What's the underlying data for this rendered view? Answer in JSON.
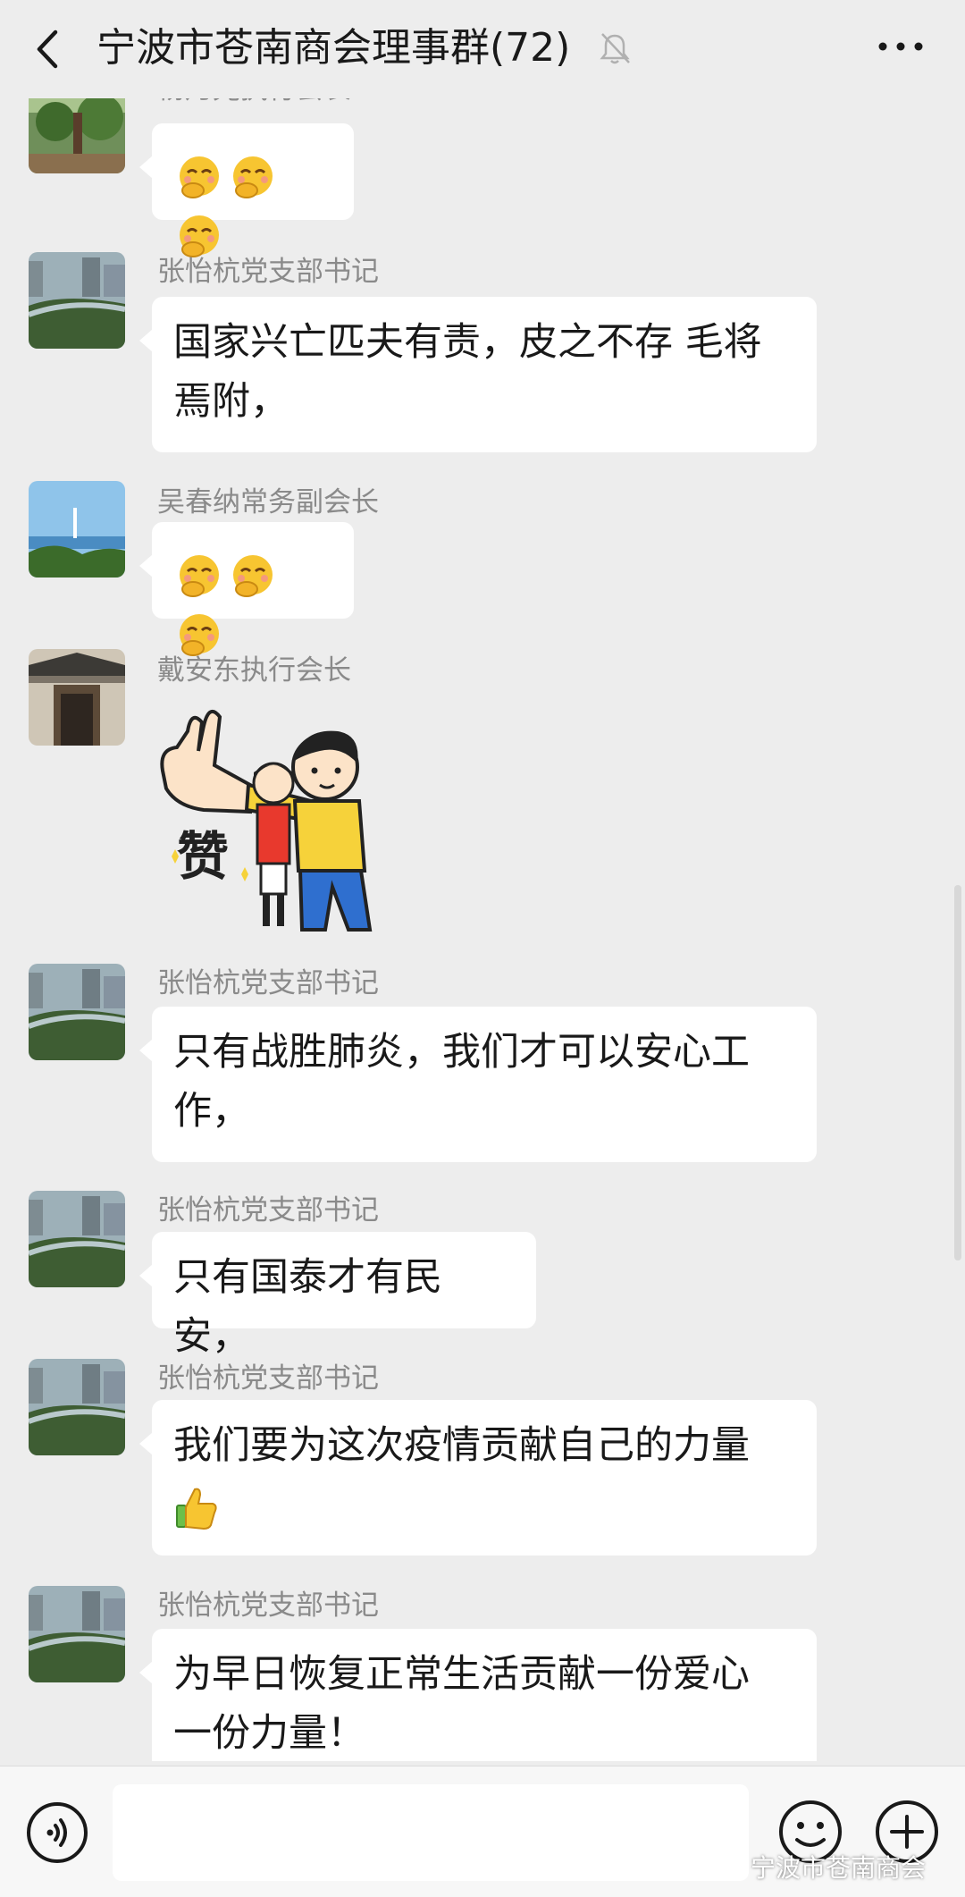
{
  "header": {
    "title": "宁波市苍南商会理事群(72)",
    "back_icon": "chevron-left-icon",
    "mute_icon": "bell-off-icon",
    "more_icon": "more-dots-icon"
  },
  "messages": [
    {
      "sender": "杨乃光执行会长",
      "type": "emoji",
      "emoji": "face-hand-over-mouth",
      "count": 3
    },
    {
      "sender": "张怡杭党支部书记",
      "type": "text",
      "lines": [
        "国家兴亡匹夫有责，皮之不存 毛将",
        "焉附，"
      ]
    },
    {
      "sender": "吴春纳常务副会长",
      "type": "emoji",
      "emoji": "face-hand-over-mouth",
      "count": 3
    },
    {
      "sender": "戴安东执行会长",
      "type": "sticker",
      "sticker_text": "赞"
    },
    {
      "sender": "张怡杭党支部书记",
      "type": "text",
      "lines": [
        "只有战胜肺炎，我们才可以安心工",
        "作，"
      ]
    },
    {
      "sender": "张怡杭党支部书记",
      "type": "text",
      "lines": [
        "只有国泰才有民安，"
      ]
    },
    {
      "sender": "张怡杭党支部书记",
      "type": "text",
      "lines": [
        "我们要为这次疫情贡献自己的力量"
      ],
      "trailing_emoji": "thumbs-up"
    },
    {
      "sender": "张怡杭党支部书记",
      "type": "text",
      "lines": [
        "为早日恢复正常生活贡献一份爱心",
        "一份力量！"
      ]
    }
  ],
  "footer": {
    "voice_icon": "voice-icon",
    "emoji_icon": "smiley-icon",
    "plus_icon": "plus-circle-icon"
  },
  "watermark": "宁波市苍南商会",
  "colors": {
    "background": "#ededed",
    "bubble": "#ffffff",
    "sender_text": "#8a8a8a",
    "emoji_yellow": "#f7c531"
  }
}
